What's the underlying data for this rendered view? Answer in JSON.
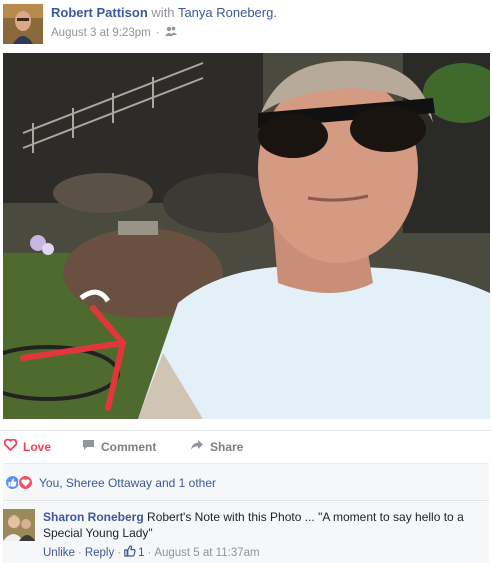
{
  "post": {
    "author": "Robert Pattison",
    "with_text": "with",
    "tagged": "Tanya Roneberg.",
    "timestamp": "August 3 at 9:23pm",
    "separator": "·",
    "privacy_icon": "friends-icon"
  },
  "actions": {
    "love_label": "Love",
    "comment_label": "Comment",
    "share_label": "Share"
  },
  "reactions": {
    "summary": "You, Sheree Ottaway and 1 other",
    "icons": [
      "like-icon",
      "heart-icon"
    ]
  },
  "comment": {
    "author": "Sharon Roneberg",
    "text": "Robert's Note with this Photo ... \"A moment to say hello to a Special Young Lady\"",
    "unlike_label": "Unlike",
    "reply_label": "Reply",
    "like_count": "1",
    "timestamp": "August 5 at 11:37am",
    "separator": "·"
  },
  "colors": {
    "link": "#3b5998",
    "love": "#f33e58",
    "muted": "#90949c",
    "like_blue": "#5890ff"
  }
}
